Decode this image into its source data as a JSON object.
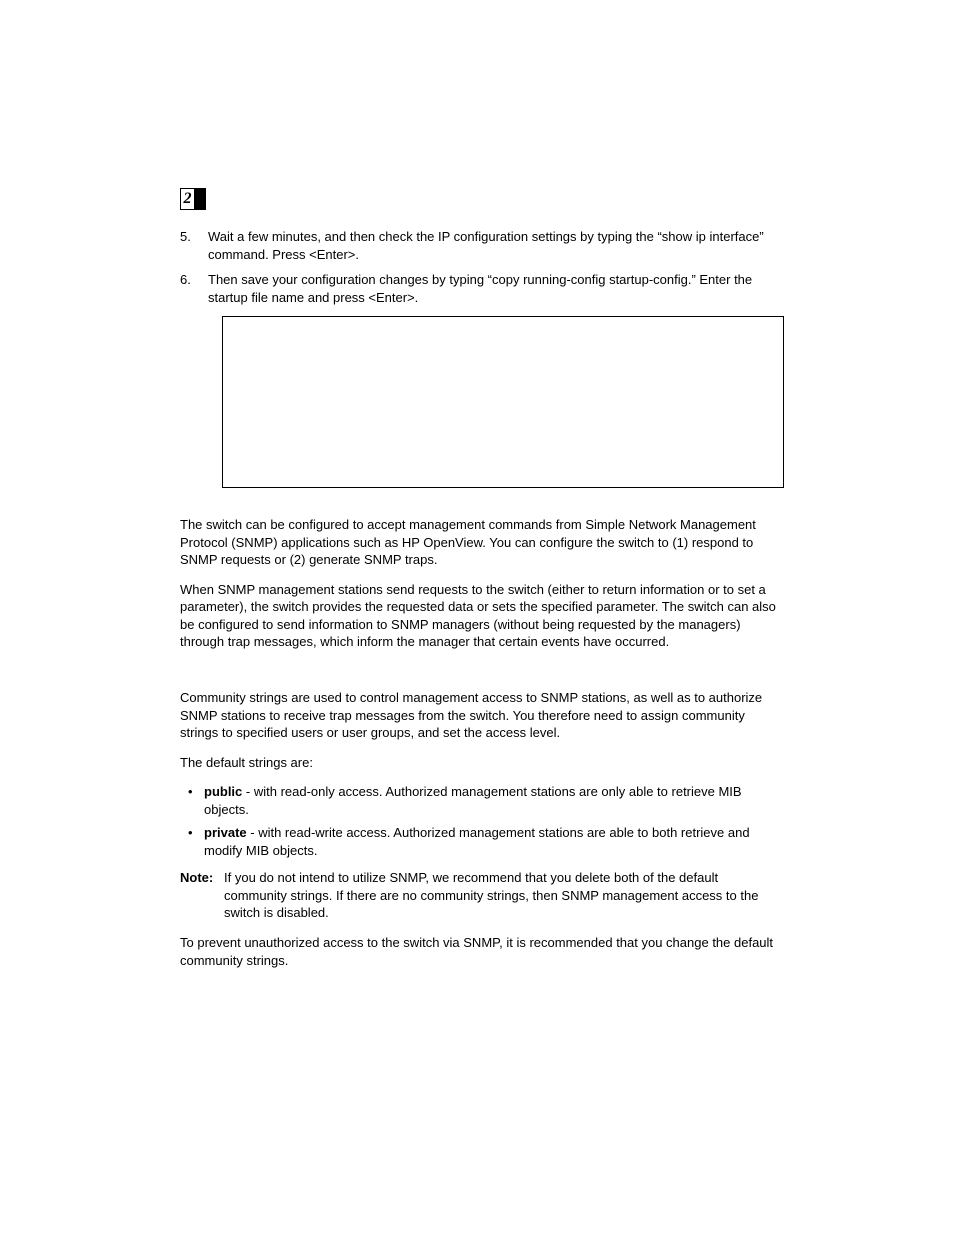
{
  "chapter": {
    "number": "2"
  },
  "steps": [
    {
      "n": "5.",
      "text": "Wait a few minutes, and then check the IP configuration settings by typing the “show ip interface” command. Press <Enter>."
    },
    {
      "n": "6.",
      "text": "Then save your configuration changes by typing “copy running-config startup-config.” Enter the startup file name and press <Enter>."
    }
  ],
  "snmp_intro1": "The switch can be configured to accept management commands from Simple Network Management Protocol (SNMP) applications such as HP OpenView. You can configure the switch to (1) respond to SNMP requests or (2) generate SNMP traps.",
  "snmp_intro2": "When SNMP management stations send requests to the switch (either to return information or to set a parameter), the switch provides the requested data or sets the specified parameter. The switch can also be configured to send information to SNMP managers (without being requested by the managers) through trap messages, which inform the manager that certain events have occurred.",
  "community_intro": "Community strings are used to control management access to SNMP stations, as well as to authorize SNMP stations to receive trap messages from the switch. You therefore need to assign community strings to specified users or user groups, and set the access level.",
  "defaults_lead": "The default strings are:",
  "defaults": [
    {
      "name": "public",
      "desc": " - with read-only access. Authorized management stations are only able to retrieve MIB objects."
    },
    {
      "name": "private",
      "desc": " - with read-write access. Authorized management stations are able to both retrieve and modify MIB objects."
    }
  ],
  "note": {
    "label": "Note:",
    "text": "If you do not intend to utilize SNMP, we recommend that you delete both of the default community strings. If there are no community strings, then SNMP management access to the switch is disabled."
  },
  "closing": "To prevent unauthorized access to the switch via SNMP, it is recommended that you change the default community strings."
}
